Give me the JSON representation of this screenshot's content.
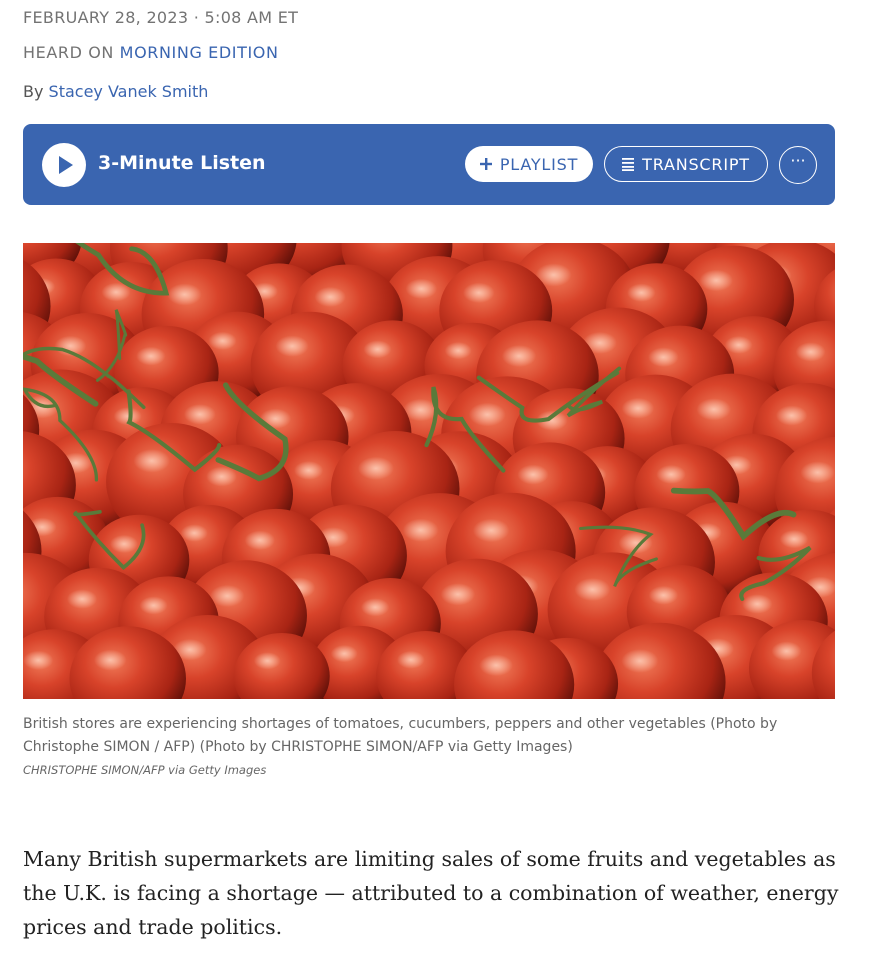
{
  "article": {
    "date": "FEBRUARY 28, 2023 · 5:08 AM ET",
    "heard_prefix": "HEARD ON ",
    "heard_show": "MORNING EDITION",
    "by_prefix": "By ",
    "author": "Stacey Vanek Smith"
  },
  "player": {
    "listen_label": "3-Minute Listen",
    "playlist_label": "PLAYLIST",
    "transcript_label": "TRANSCRIPT",
    "more_label": "···",
    "accent_color": "#3a65b0"
  },
  "photo": {
    "caption": "British stores are experiencing shortages of tomatoes, cucumbers, peppers and other vegetables (Photo by Christophe SIMON / AFP) (Photo by CHRISTOPHE SIMON/AFP via Getty Images)",
    "credit_main": "CHRISTOPHE SIMON/AFP",
    "credit_suffix": " via Getty Images"
  },
  "body": {
    "paragraph_1": "Many British supermarkets are limiting sales of some fruits and vegetables as the U.K. is facing a shortage — attributed to a combination of weather, energy prices and trade politics."
  }
}
